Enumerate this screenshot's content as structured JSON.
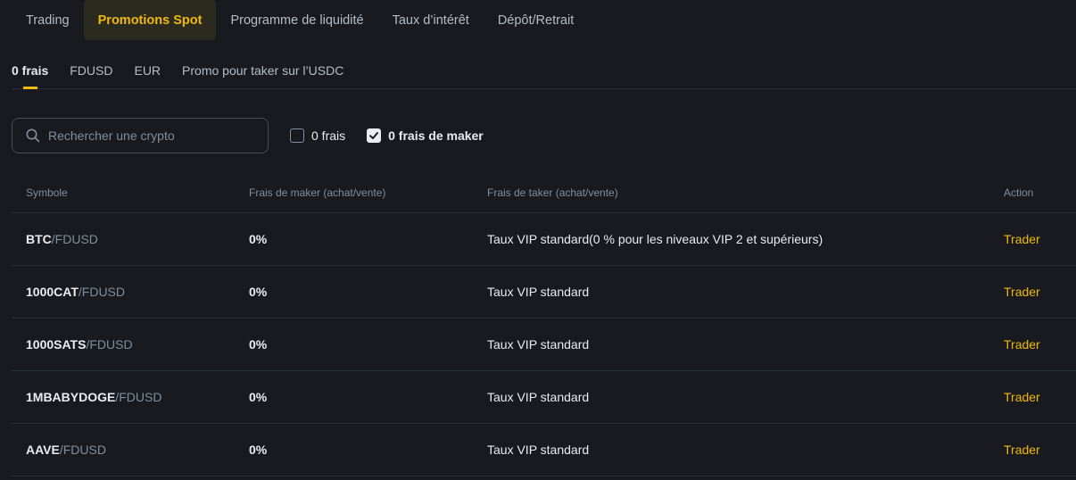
{
  "top_tabs": [
    {
      "label": "Trading"
    },
    {
      "label": "Promotions Spot"
    },
    {
      "label": "Programme de liquidité"
    },
    {
      "label": "Taux d’intérêt"
    },
    {
      "label": "Dépôt/Retrait"
    }
  ],
  "sub_tabs": [
    {
      "label": "0 frais"
    },
    {
      "label": "FDUSD"
    },
    {
      "label": "EUR"
    },
    {
      "label": "Promo pour taker sur l’USDC"
    }
  ],
  "filters": {
    "search_placeholder": "Rechercher une crypto",
    "zero_fee_label": "0 frais",
    "zero_fee_checked": false,
    "zero_maker_label": "0 frais de maker",
    "zero_maker_checked": true
  },
  "table": {
    "headers": {
      "symbol": "Symbole",
      "maker": "Frais de maker (achat/vente)",
      "taker": "Frais de taker (achat/vente)",
      "action": "Action"
    },
    "rows": [
      {
        "base": "BTC",
        "quote": "/FDUSD",
        "maker": "0%",
        "taker": "Taux VIP standard(0 % pour les niveaux VIP 2 et supérieurs)",
        "action": "Trader"
      },
      {
        "base": "1000CAT",
        "quote": "/FDUSD",
        "maker": "0%",
        "taker": "Taux VIP standard",
        "action": "Trader"
      },
      {
        "base": "1000SATS",
        "quote": "/FDUSD",
        "maker": "0%",
        "taker": "Taux VIP standard",
        "action": "Trader"
      },
      {
        "base": "1MBABYDOGE",
        "quote": "/FDUSD",
        "maker": "0%",
        "taker": "Taux VIP standard",
        "action": "Trader"
      },
      {
        "base": "AAVE",
        "quote": "/FDUSD",
        "maker": "0%",
        "taker": "Taux VIP standard",
        "action": "Trader"
      }
    ]
  },
  "colors": {
    "background": "#181a20",
    "accent": "#f0b90b",
    "divider": "#2b3139",
    "muted_text": "#848e9c"
  }
}
